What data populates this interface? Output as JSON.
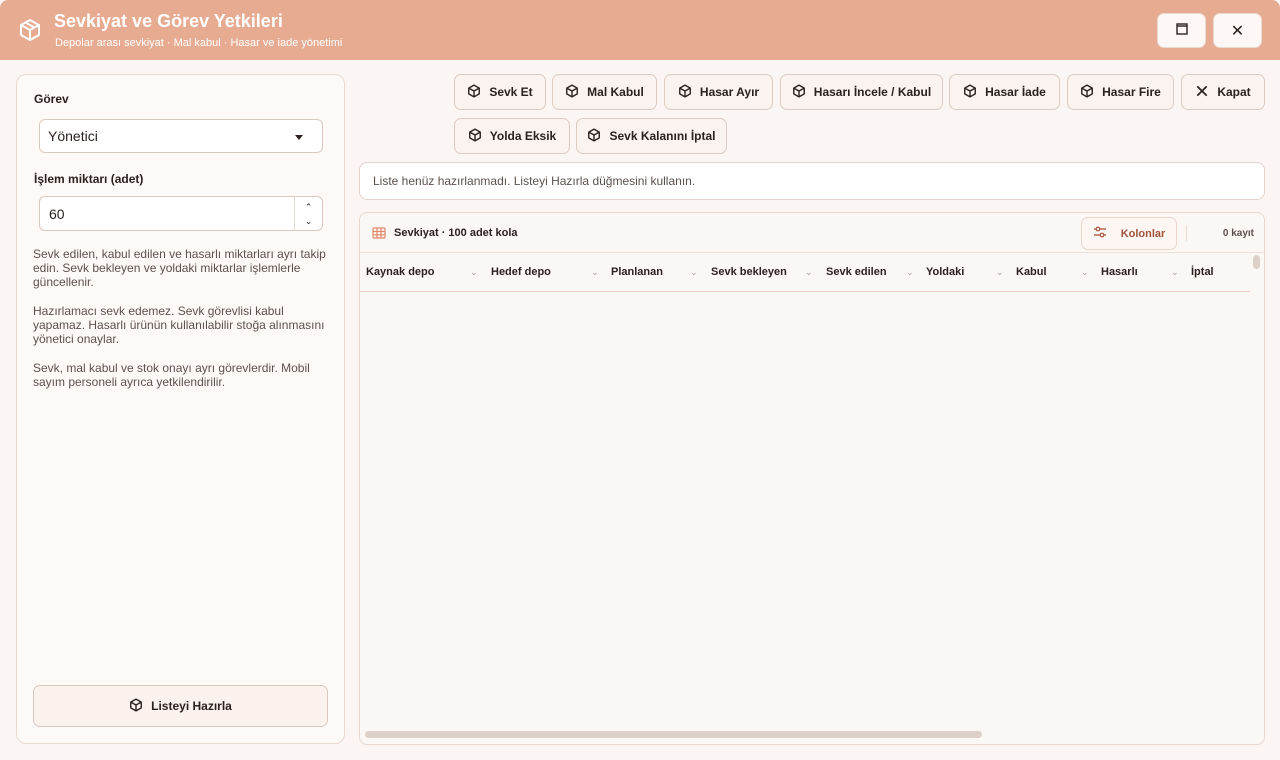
{
  "window": {
    "title": "Sevkiyat ve Görev Yetkileri",
    "subtitle": "Depolar arası sevkiyat · Mal kabul · Hasar ve iade yönetimi",
    "maximize_glyph": "🗖",
    "close_glyph": "✕"
  },
  "sidebar": {
    "role_label": "Görev",
    "role_value": "Yönetici",
    "qty_label": "İşlem miktarı (adet)",
    "qty_value": "60",
    "spin_up": "⌃",
    "spin_down": "⌄",
    "notes": [
      "Sevk edilen, kabul edilen ve hasarlı miktarları ayrı takip edin. Sevk bekleyen ve yoldaki miktarlar işlemlerle güncellenir.",
      "Hazırlamacı sevk edemez. Sevk görevlisi kabul yapamaz. Hasarlı ürünün kullanılabilir stoğa alınmasını yönetici onaylar.",
      "Sevk, mal kabul ve stok onayı ayrı görevlerdir. Mobil sayım personeli ayrıca yetkilendirilir."
    ],
    "prepare_button": "Listeyi Hazırla"
  },
  "toolbar": {
    "buttons": [
      "Sevk Et",
      "Mal Kabul",
      "Hasar Ayır",
      "Hasarı İncele / Kabul",
      "Hasar İade",
      "Hasar Fire",
      "Kapat",
      "Yolda Eksik",
      "Sevk Kalanını İptal"
    ]
  },
  "info": {
    "message": "Liste henüz hazırlanmadı. Listeyi Hazırla düğmesini kullanın."
  },
  "grid": {
    "title": "Sevkiyat · 100 adet kola",
    "columns_button": "Kolonlar",
    "count": "0 kayıt",
    "columns": [
      "Kaynak depo",
      "Hedef depo",
      "Planlanan",
      "Sevk bekleyen",
      "Sevk edilen",
      "Yoldaki",
      "Kabul",
      "Hasarlı",
      "İptal"
    ],
    "sort_glyph": "⌄"
  },
  "colors": {
    "titlebar": "#e6ab91",
    "accent": "#a0523a",
    "panel": "#fdf9f7"
  }
}
